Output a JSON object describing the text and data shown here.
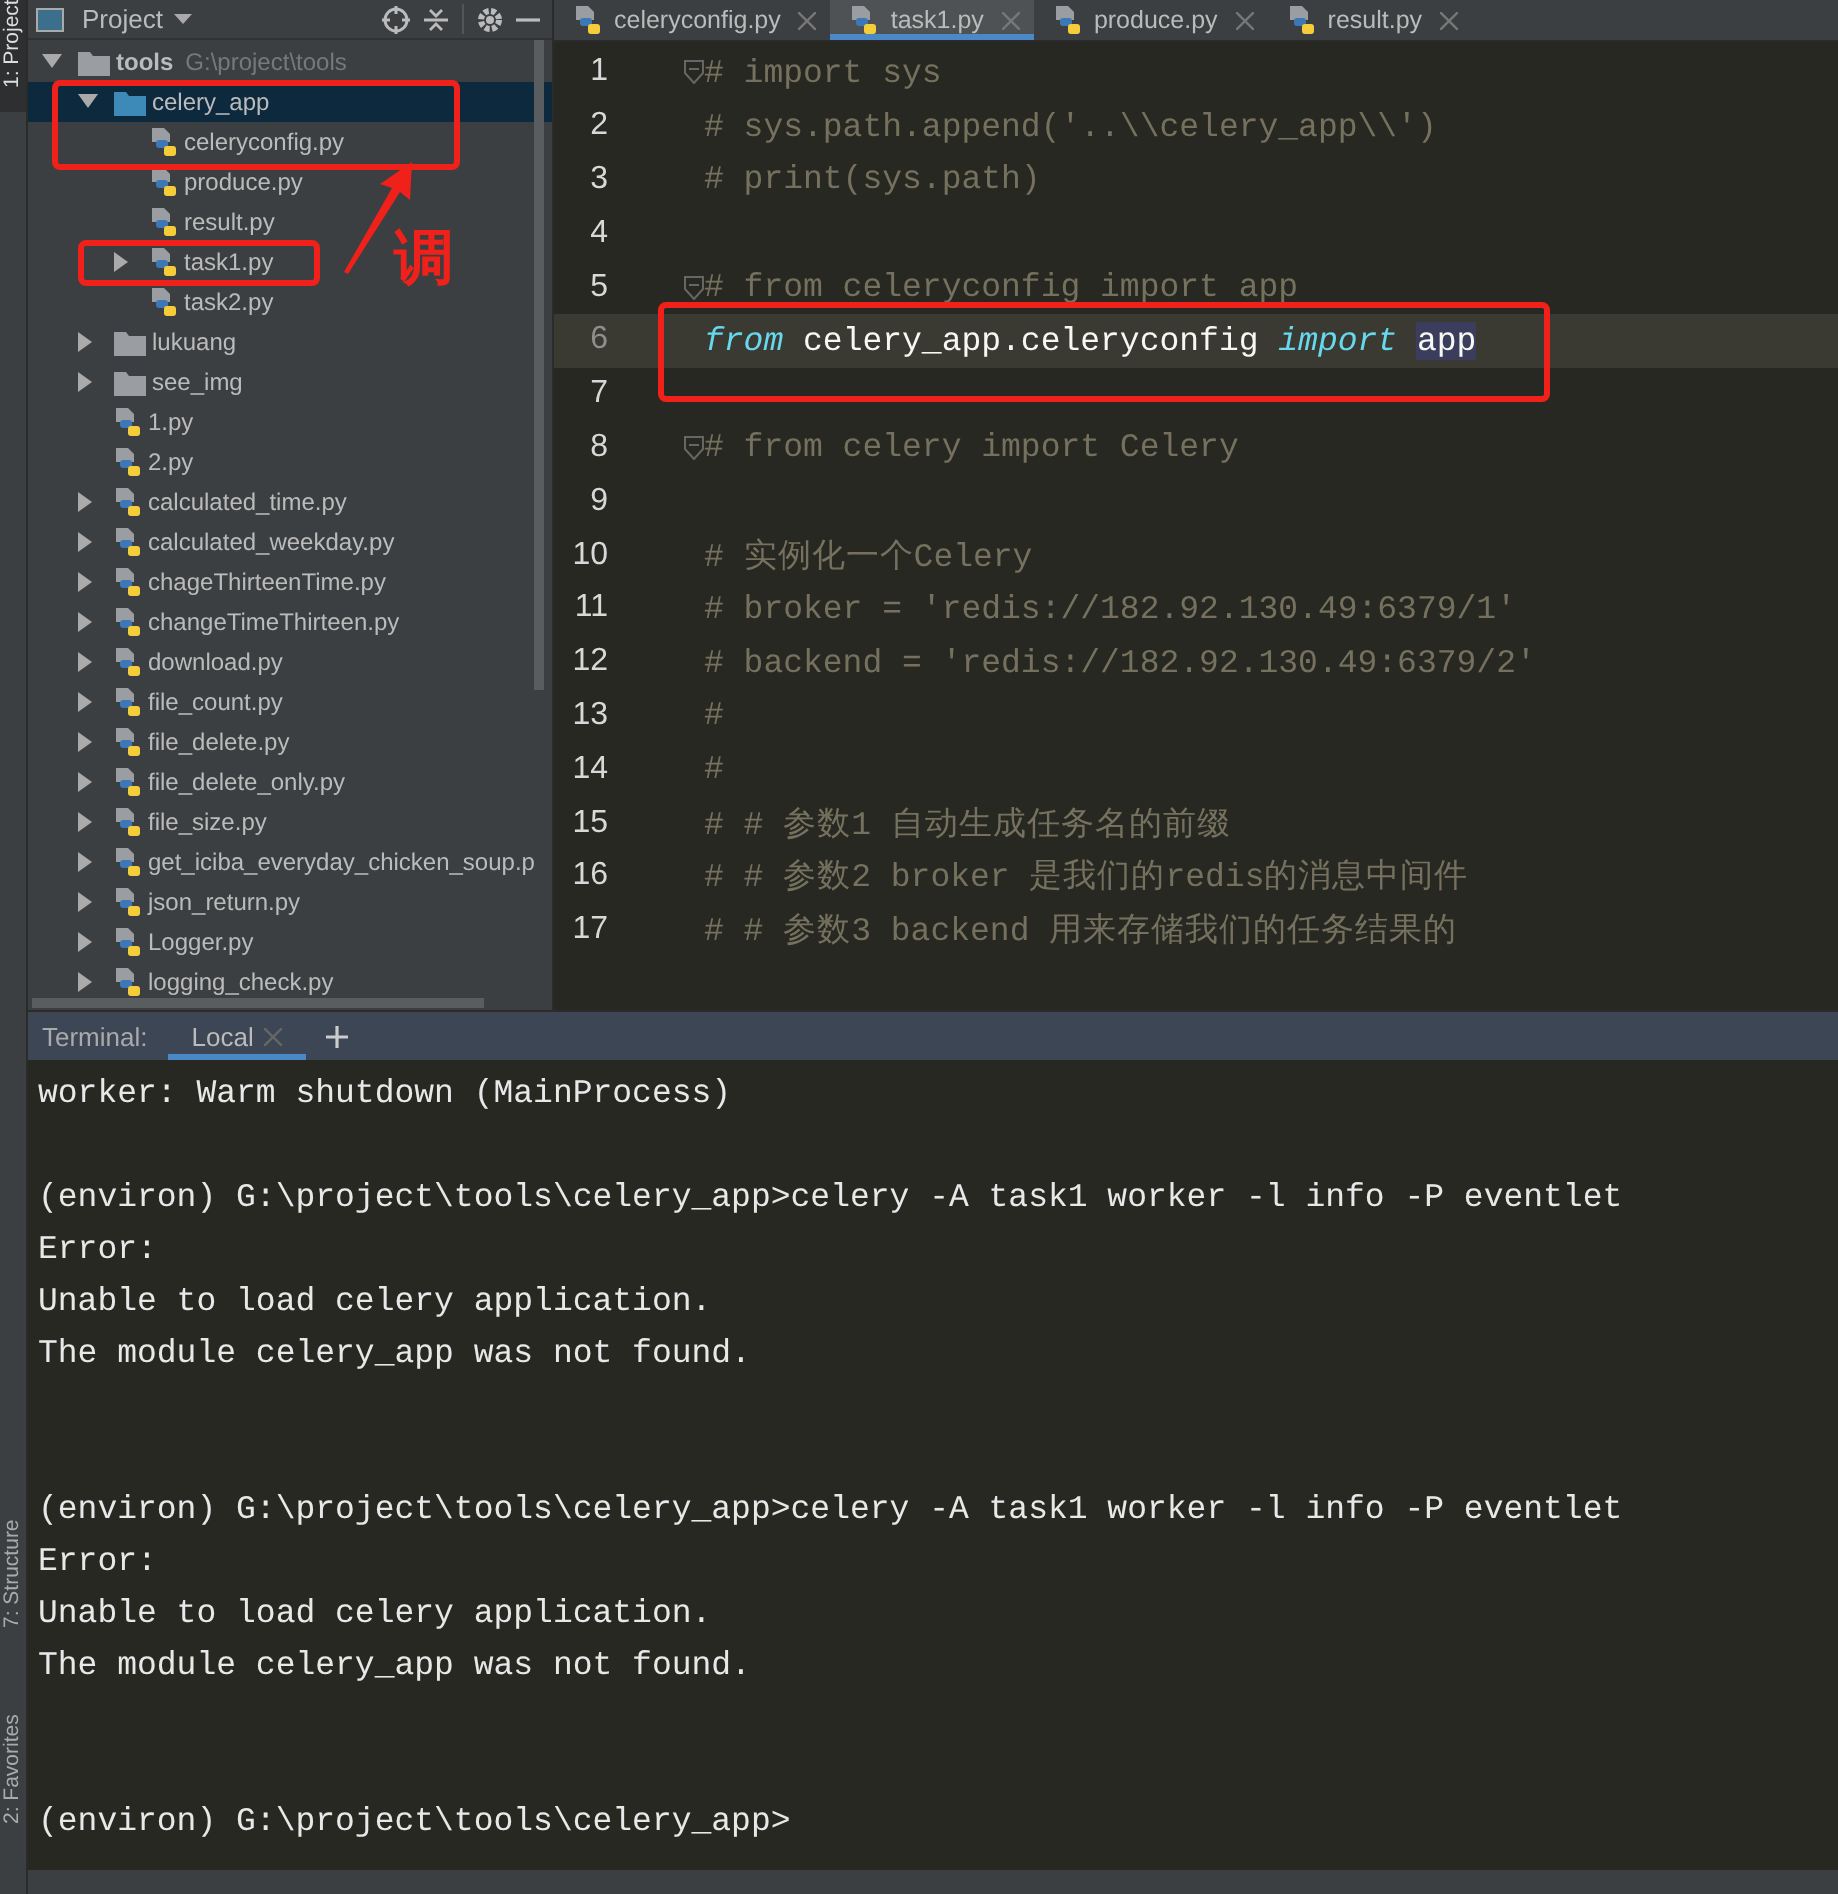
{
  "tool_strip": [
    {
      "label": "1: Project",
      "selected": true
    },
    {
      "label": "7: Structure",
      "selected": false
    },
    {
      "label": "2: Favorites",
      "selected": false
    }
  ],
  "project_panel": {
    "title": "Project",
    "tree": [
      {
        "name": "tools",
        "path": "G:\\project\\tools",
        "kind": "folder",
        "expanded": true,
        "selected": false,
        "children": [
          {
            "name": "celery_app",
            "kind": "folder",
            "expanded": true,
            "selected": true,
            "children": [
              {
                "name": "celeryconfig.py",
                "kind": "file",
                "selected": false
              },
              {
                "name": "produce.py",
                "kind": "file",
                "selected": false
              },
              {
                "name": "result.py",
                "kind": "file",
                "selected": false
              },
              {
                "name": "task1.py",
                "kind": "file",
                "expanded": false,
                "selected": false
              },
              {
                "name": "task2.py",
                "kind": "file",
                "selected": false
              }
            ]
          },
          {
            "name": "lukuang",
            "kind": "folder",
            "expanded": false,
            "selected": false
          },
          {
            "name": "see_img",
            "kind": "folder",
            "expanded": false,
            "selected": false
          },
          {
            "name": "1.py",
            "kind": "file",
            "selected": false
          },
          {
            "name": "2.py",
            "kind": "file",
            "selected": false
          },
          {
            "name": "calculated_time.py",
            "kind": "file",
            "expanded": false,
            "selected": false
          },
          {
            "name": "calculated_weekday.py",
            "kind": "file",
            "expanded": false,
            "selected": false
          },
          {
            "name": "chageThirteenTime.py",
            "kind": "file",
            "expanded": false,
            "selected": false
          },
          {
            "name": "changeTimeThirteen.py",
            "kind": "file",
            "expanded": false,
            "selected": false
          },
          {
            "name": "download.py",
            "kind": "file",
            "expanded": false,
            "selected": false
          },
          {
            "name": "file_count.py",
            "kind": "file",
            "expanded": false,
            "selected": false
          },
          {
            "name": "file_delete.py",
            "kind": "file",
            "expanded": false,
            "selected": false
          },
          {
            "name": "file_delete_only.py",
            "kind": "file",
            "expanded": false,
            "selected": false
          },
          {
            "name": "file_size.py",
            "kind": "file",
            "expanded": false,
            "selected": false
          },
          {
            "name": "get_iciba_everyday_chicken_soup.p",
            "kind": "file",
            "expanded": false,
            "selected": false
          },
          {
            "name": "json_return.py",
            "kind": "file",
            "expanded": false,
            "selected": false
          },
          {
            "name": "Logger.py",
            "kind": "file",
            "expanded": false,
            "selected": false
          },
          {
            "name": "logging_check.py",
            "kind": "file",
            "expanded": false,
            "selected": false
          }
        ]
      }
    ]
  },
  "editor": {
    "tabs": [
      {
        "label": "celeryconfig.py",
        "selected": false
      },
      {
        "label": "task1.py",
        "selected": true
      },
      {
        "label": "produce.py",
        "selected": false
      },
      {
        "label": "result.py",
        "selected": false
      }
    ],
    "lines": [
      {
        "number": "1",
        "fold": true,
        "current": false,
        "segments": [
          {
            "text": "# import sys",
            "kind": "comment"
          }
        ]
      },
      {
        "number": "2",
        "current": false,
        "segments": [
          {
            "text": "# sys.path.append('..\\\\celery_app\\\\')",
            "kind": "comment"
          }
        ]
      },
      {
        "number": "3",
        "current": false,
        "segments": [
          {
            "text": "# print(sys.path)",
            "kind": "comment"
          }
        ]
      },
      {
        "number": "4",
        "current": false
      },
      {
        "number": "5",
        "fold": true,
        "current": false,
        "segments": [
          {
            "text": "# from celeryconfig import app",
            "kind": "comment"
          }
        ]
      },
      {
        "number": "6",
        "current": true,
        "segments": [
          {
            "text": "from",
            "kind": "keyword"
          },
          {
            "text": " celery_app.celeryconfig ",
            "kind": "plain"
          },
          {
            "text": "import",
            "kind": "keyword"
          },
          {
            "text": "app",
            "kind": "highlight"
          }
        ]
      },
      {
        "number": "7",
        "current": false
      },
      {
        "number": "8",
        "fold": true,
        "current": false,
        "segments": [
          {
            "text": "# from celery import Celery",
            "kind": "comment"
          }
        ]
      },
      {
        "number": "9",
        "current": false
      },
      {
        "number": "10",
        "current": false,
        "segments": [
          {
            "text": "# 实例化一个Celery",
            "kind": "comment"
          }
        ]
      },
      {
        "number": "11",
        "current": false,
        "segments": [
          {
            "text": "# broker = 'redis://182.92.130.49:6379/1'",
            "kind": "comment"
          }
        ]
      },
      {
        "number": "12",
        "current": false,
        "segments": [
          {
            "text": "# backend = 'redis://182.92.130.49:6379/2'",
            "kind": "comment"
          }
        ]
      },
      {
        "number": "13",
        "current": false,
        "segments": [
          {
            "text": "#",
            "kind": "comment"
          }
        ]
      },
      {
        "number": "14",
        "current": false,
        "segments": [
          {
            "text": "#",
            "kind": "comment"
          }
        ]
      },
      {
        "number": "15",
        "current": false,
        "segments": [
          {
            "text": "# # 参数1 自动生成任务名的前缀",
            "kind": "comment"
          }
        ]
      },
      {
        "number": "16",
        "current": false,
        "segments": [
          {
            "text": "# # 参数2 broker 是我们的redis的消息中间件",
            "kind": "comment"
          }
        ]
      },
      {
        "number": "17",
        "current": false,
        "segments": [
          {
            "text": "# # 参数3 backend 用来存储我们的任务结果的",
            "kind": "comment"
          }
        ]
      }
    ]
  },
  "terminal": {
    "label": "Terminal:",
    "tabs": [
      {
        "label": "Local",
        "selected": true
      }
    ],
    "lines": [
      {
        "kind": "text",
        "text": "worker: Warm shutdown (MainProcess)"
      },
      {
        "kind": "blank"
      },
      {
        "kind": "text",
        "text": "(environ) G:\\project\\tools\\celery_app>celery -A task1 worker -l info -P eventlet"
      },
      {
        "kind": "text",
        "text": "Error:"
      },
      {
        "kind": "text",
        "text": "Unable to load celery application."
      },
      {
        "kind": "text",
        "text": "The module celery_app was not found."
      },
      {
        "kind": "blank"
      },
      {
        "kind": "blank"
      },
      {
        "kind": "text",
        "text": "(environ) G:\\project\\tools\\celery_app>celery -A task1 worker -l info -P eventlet"
      },
      {
        "kind": "text",
        "text": "Error:"
      },
      {
        "kind": "text",
        "text": "Unable to load celery application."
      },
      {
        "kind": "text",
        "text": "The module celery_app was not found."
      },
      {
        "kind": "blank"
      },
      {
        "kind": "blank"
      },
      {
        "kind": "text",
        "text": "(environ) G:\\project\\tools\\celery_app>"
      }
    ]
  },
  "annotation": {
    "note": "调"
  }
}
